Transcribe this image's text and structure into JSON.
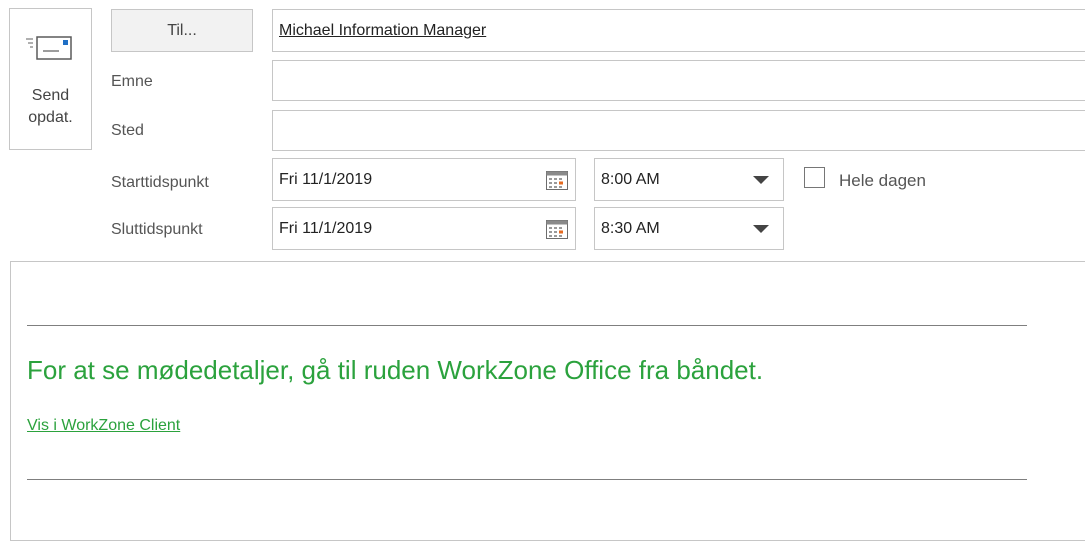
{
  "send_button": {
    "line1": "Send",
    "line2": "opdat.",
    "icon": "envelope-send-icon"
  },
  "to_button": {
    "label": "Til..."
  },
  "to_field": {
    "value": "Michael Information Manager"
  },
  "subject": {
    "label": "Emne",
    "value": ""
  },
  "location": {
    "label": "Sted",
    "value": ""
  },
  "start": {
    "label": "Starttidspunkt",
    "date": "Fri 11/1/2019",
    "time": "8:00 AM"
  },
  "end": {
    "label": "Sluttidspunkt",
    "date": "Fri 11/1/2019",
    "time": "8:30 AM"
  },
  "all_day": {
    "label": "Hele dagen",
    "checked": false
  },
  "body": {
    "info_text": "For at se mødedetaljer, gå til ruden WorkZone Office fra båndet.",
    "link_text": "Vis i WorkZone Client"
  },
  "colors": {
    "accent_green": "#2ba23d",
    "border": "#c6c6c6"
  }
}
